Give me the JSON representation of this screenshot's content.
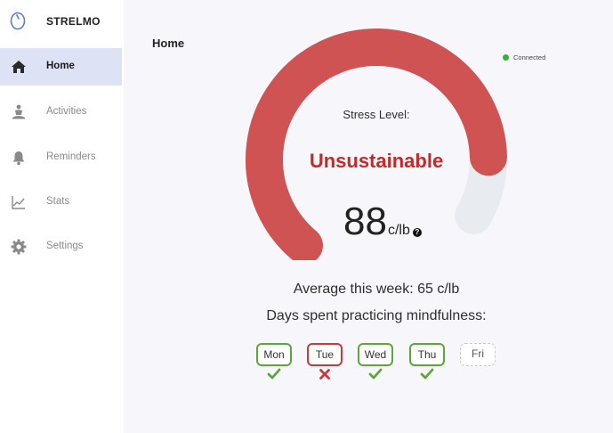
{
  "app": {
    "name": "STRELMO",
    "logo_icon": "mouse-icon"
  },
  "sidebar": {
    "items": [
      {
        "label": "Home",
        "icon": "home-icon",
        "active": true
      },
      {
        "label": "Activities",
        "icon": "meditation-icon",
        "active": false
      },
      {
        "label": "Reminders",
        "icon": "bell-icon",
        "active": false
      },
      {
        "label": "Stats",
        "icon": "chart-line-icon",
        "active": false
      },
      {
        "label": "Settings",
        "icon": "gear-icon",
        "active": false
      }
    ]
  },
  "header": {
    "title": "Home",
    "status": "Connected",
    "status_color": "#3cae3c"
  },
  "gauge": {
    "label": "Stress Level:",
    "state": "Unsustainable",
    "value": "88",
    "unit": "c/lb",
    "fill_fraction": 0.88,
    "fill_color": "#d05353",
    "track_color": "#e8ebf0",
    "help_icon": "question-circle-icon"
  },
  "summary": {
    "average_text": "Average this week: 65 c/lb",
    "mindfulness_heading": "Days spent practicing mindfulness:"
  },
  "days": [
    {
      "label": "Mon",
      "status": "done"
    },
    {
      "label": "Tue",
      "status": "missed"
    },
    {
      "label": "Wed",
      "status": "done"
    },
    {
      "label": "Thu",
      "status": "done"
    },
    {
      "label": "Fri",
      "status": "pending"
    }
  ],
  "colors": {
    "accent_active": "#dde3f5",
    "done": "#5ca73a",
    "missed": "#c83a3a"
  }
}
